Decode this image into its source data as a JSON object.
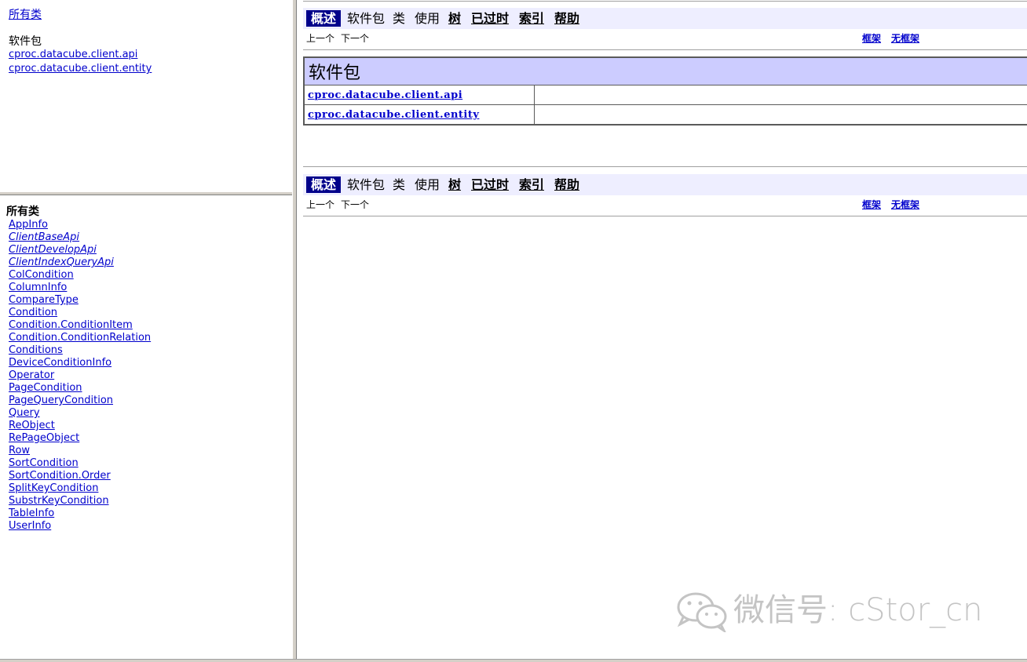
{
  "package_frame": {
    "all_classes_link": "所有类",
    "heading": "软件包",
    "packages": [
      "cproc.datacube.client.api",
      "cproc.datacube.client.entity"
    ]
  },
  "classes_frame": {
    "heading": "所有类",
    "classes": [
      {
        "name": "AppInfo",
        "interface": false
      },
      {
        "name": "ClientBaseApi",
        "interface": true
      },
      {
        "name": "ClientDevelopApi",
        "interface": true
      },
      {
        "name": "ClientIndexQueryApi",
        "interface": true
      },
      {
        "name": "ColCondition",
        "interface": false
      },
      {
        "name": "ColumnInfo",
        "interface": false
      },
      {
        "name": "CompareType",
        "interface": false
      },
      {
        "name": "Condition",
        "interface": false
      },
      {
        "name": "Condition.ConditionItem",
        "interface": false
      },
      {
        "name": "Condition.ConditionRelation",
        "interface": false
      },
      {
        "name": "Conditions",
        "interface": false
      },
      {
        "name": "DeviceConditionInfo",
        "interface": false
      },
      {
        "name": "Operator",
        "interface": false
      },
      {
        "name": "PageCondition",
        "interface": false
      },
      {
        "name": "PageQueryCondition",
        "interface": false
      },
      {
        "name": "Query",
        "interface": false
      },
      {
        "name": "ReObject",
        "interface": false
      },
      {
        "name": "RePageObject",
        "interface": false
      },
      {
        "name": "Row",
        "interface": false
      },
      {
        "name": "SortCondition",
        "interface": false
      },
      {
        "name": "SortCondition.Order",
        "interface": false
      },
      {
        "name": "SplitKeyCondition",
        "interface": false
      },
      {
        "name": "SubstrKeyCondition",
        "interface": false
      },
      {
        "name": "TableInfo",
        "interface": false
      },
      {
        "name": "UserInfo",
        "interface": false
      }
    ]
  },
  "navbar": {
    "overview": "概述",
    "package": "软件包",
    "class": "类",
    "use": "使用",
    "tree": "树",
    "deprecated": "已过时",
    "index": "索引",
    "help": "帮助",
    "prev": "上一个",
    "next": "下一个",
    "frames": "框架",
    "no_frames": "无框架"
  },
  "overview_table": {
    "heading": "软件包",
    "rows": [
      {
        "package": "cproc.datacube.client.api",
        "description": ""
      },
      {
        "package": "cproc.datacube.client.entity",
        "description": ""
      }
    ]
  },
  "watermark": {
    "icon": "wechat-icon",
    "text": "微信号: cStor_cn"
  },
  "colors": {
    "navbar_bg": "#eeeeff",
    "nav_active_bg": "#00008b",
    "table_header_bg": "#ccccff",
    "link": "#0000cc"
  }
}
